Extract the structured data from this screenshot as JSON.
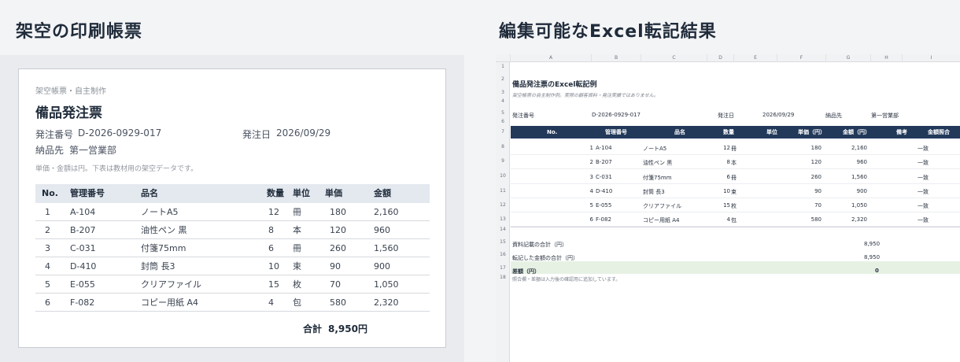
{
  "left": {
    "heading": "架空の印刷帳票",
    "doc": {
      "kicker": "架空帳票・自主制作",
      "title": "備品発注票",
      "order_no_label": "発注番号",
      "order_no": "D-2026-0929-017",
      "order_date_label": "発注日",
      "order_date": "2026/09/29",
      "deliver_label": "納品先",
      "deliver_to": "第一営業部",
      "note": "単価・金額は円。下表は教材用の架空データです。",
      "columns": [
        "No.",
        "管理番号",
        "品名",
        "数量",
        "単位",
        "単価",
        "金額"
      ],
      "rows": [
        [
          "1",
          "A-104",
          "ノートA5",
          "12",
          "冊",
          "180",
          "2,160"
        ],
        [
          "2",
          "B-207",
          "油性ペン 黒",
          "8",
          "本",
          "120",
          "960"
        ],
        [
          "3",
          "C-031",
          "付箋75mm",
          "6",
          "冊",
          "260",
          "1,560"
        ],
        [
          "4",
          "D-410",
          "封筒 長3",
          "10",
          "束",
          "90",
          "900"
        ],
        [
          "5",
          "E-055",
          "クリアファイル",
          "15",
          "枚",
          "70",
          "1,050"
        ],
        [
          "6",
          "F-082",
          "コピー用紙 A4",
          "4",
          "包",
          "580",
          "2,320"
        ]
      ],
      "total_label": "合計",
      "total_value": "8,950円"
    }
  },
  "right": {
    "heading": "編集可能なExcel転記結果",
    "sheet": {
      "col_letters": [
        "A",
        "B",
        "C",
        "D",
        "E",
        "F",
        "G",
        "H",
        "I"
      ],
      "row_numbers": [
        "1",
        "2",
        "3",
        "4",
        "5",
        "6",
        "7",
        "8",
        "9",
        "10",
        "11",
        "12",
        "13",
        "14",
        "15",
        "16",
        "17",
        "18"
      ],
      "title": "備品発注票のExcel転記例",
      "subtitle": "架空帳票の自主制作例。実際の顧客資料・発注実績ではありません。",
      "order_no_label": "発注番号",
      "order_no": "D-2026-0929-017",
      "order_date_label": "発注日",
      "order_date": "2026/09/29",
      "deliver_label": "納品先",
      "deliver_to": "第一営業部",
      "columns": [
        "No.",
        "管理番号",
        "品名",
        "数量",
        "単位",
        "単価（円）",
        "金額（円）",
        "備考",
        "金額照合"
      ],
      "rows": [
        [
          "1",
          "A-104",
          "ノートA5",
          "12",
          "冊",
          "180",
          "2,160",
          "",
          "一致"
        ],
        [
          "2",
          "B-207",
          "油性ペン 黒",
          "8",
          "本",
          "120",
          "960",
          "",
          "一致"
        ],
        [
          "3",
          "C-031",
          "付箋75mm",
          "6",
          "冊",
          "260",
          "1,560",
          "",
          "一致"
        ],
        [
          "4",
          "D-410",
          "封筒 長3",
          "10",
          "束",
          "90",
          "900",
          "",
          "一致"
        ],
        [
          "5",
          "E-055",
          "クリアファイル",
          "15",
          "枚",
          "70",
          "1,050",
          "",
          "一致"
        ],
        [
          "6",
          "F-082",
          "コピー用紙 A4",
          "4",
          "包",
          "580",
          "2,320",
          "",
          "一致"
        ]
      ],
      "sum_doc_label": "資料記載の合計（円）",
      "sum_doc_value": "8,950",
      "sum_calc_label": "転記した金額の合計（円）",
      "sum_calc_value": "8,950",
      "diff_label": "差額（円）",
      "diff_value": "0",
      "footnote": "照合欄・差額は入力後の確認用に追加しています。"
    }
  }
}
